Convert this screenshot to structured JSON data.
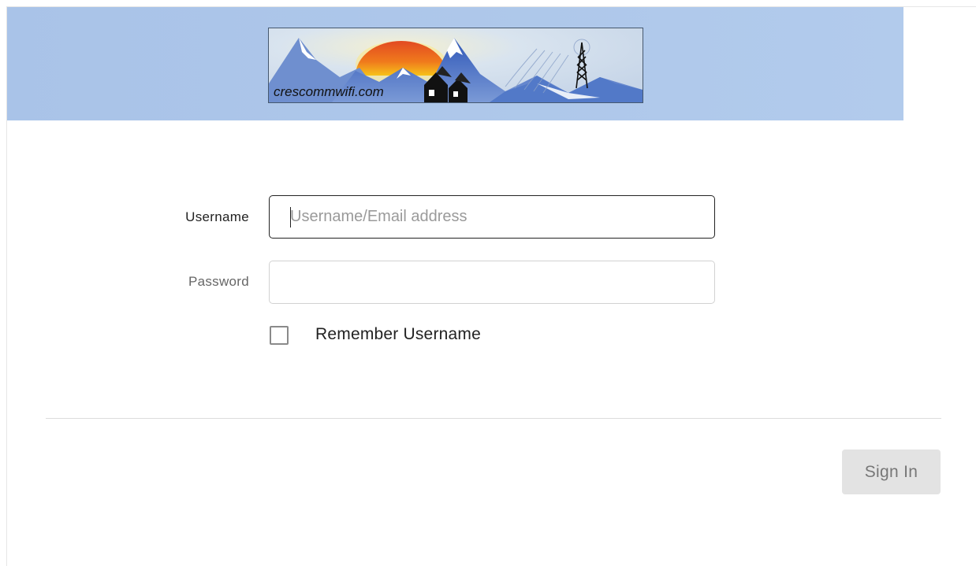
{
  "header": {
    "logo_text": "crescommwifi.com",
    "background_color": "#adc7ea"
  },
  "login": {
    "username_label": "Username",
    "username_placeholder": "Username/Email address",
    "username_value": "",
    "password_label": "Password",
    "password_value": "",
    "remember_label": "Remember Username",
    "remember_checked": false
  },
  "actions": {
    "signin_label": "Sign In"
  }
}
